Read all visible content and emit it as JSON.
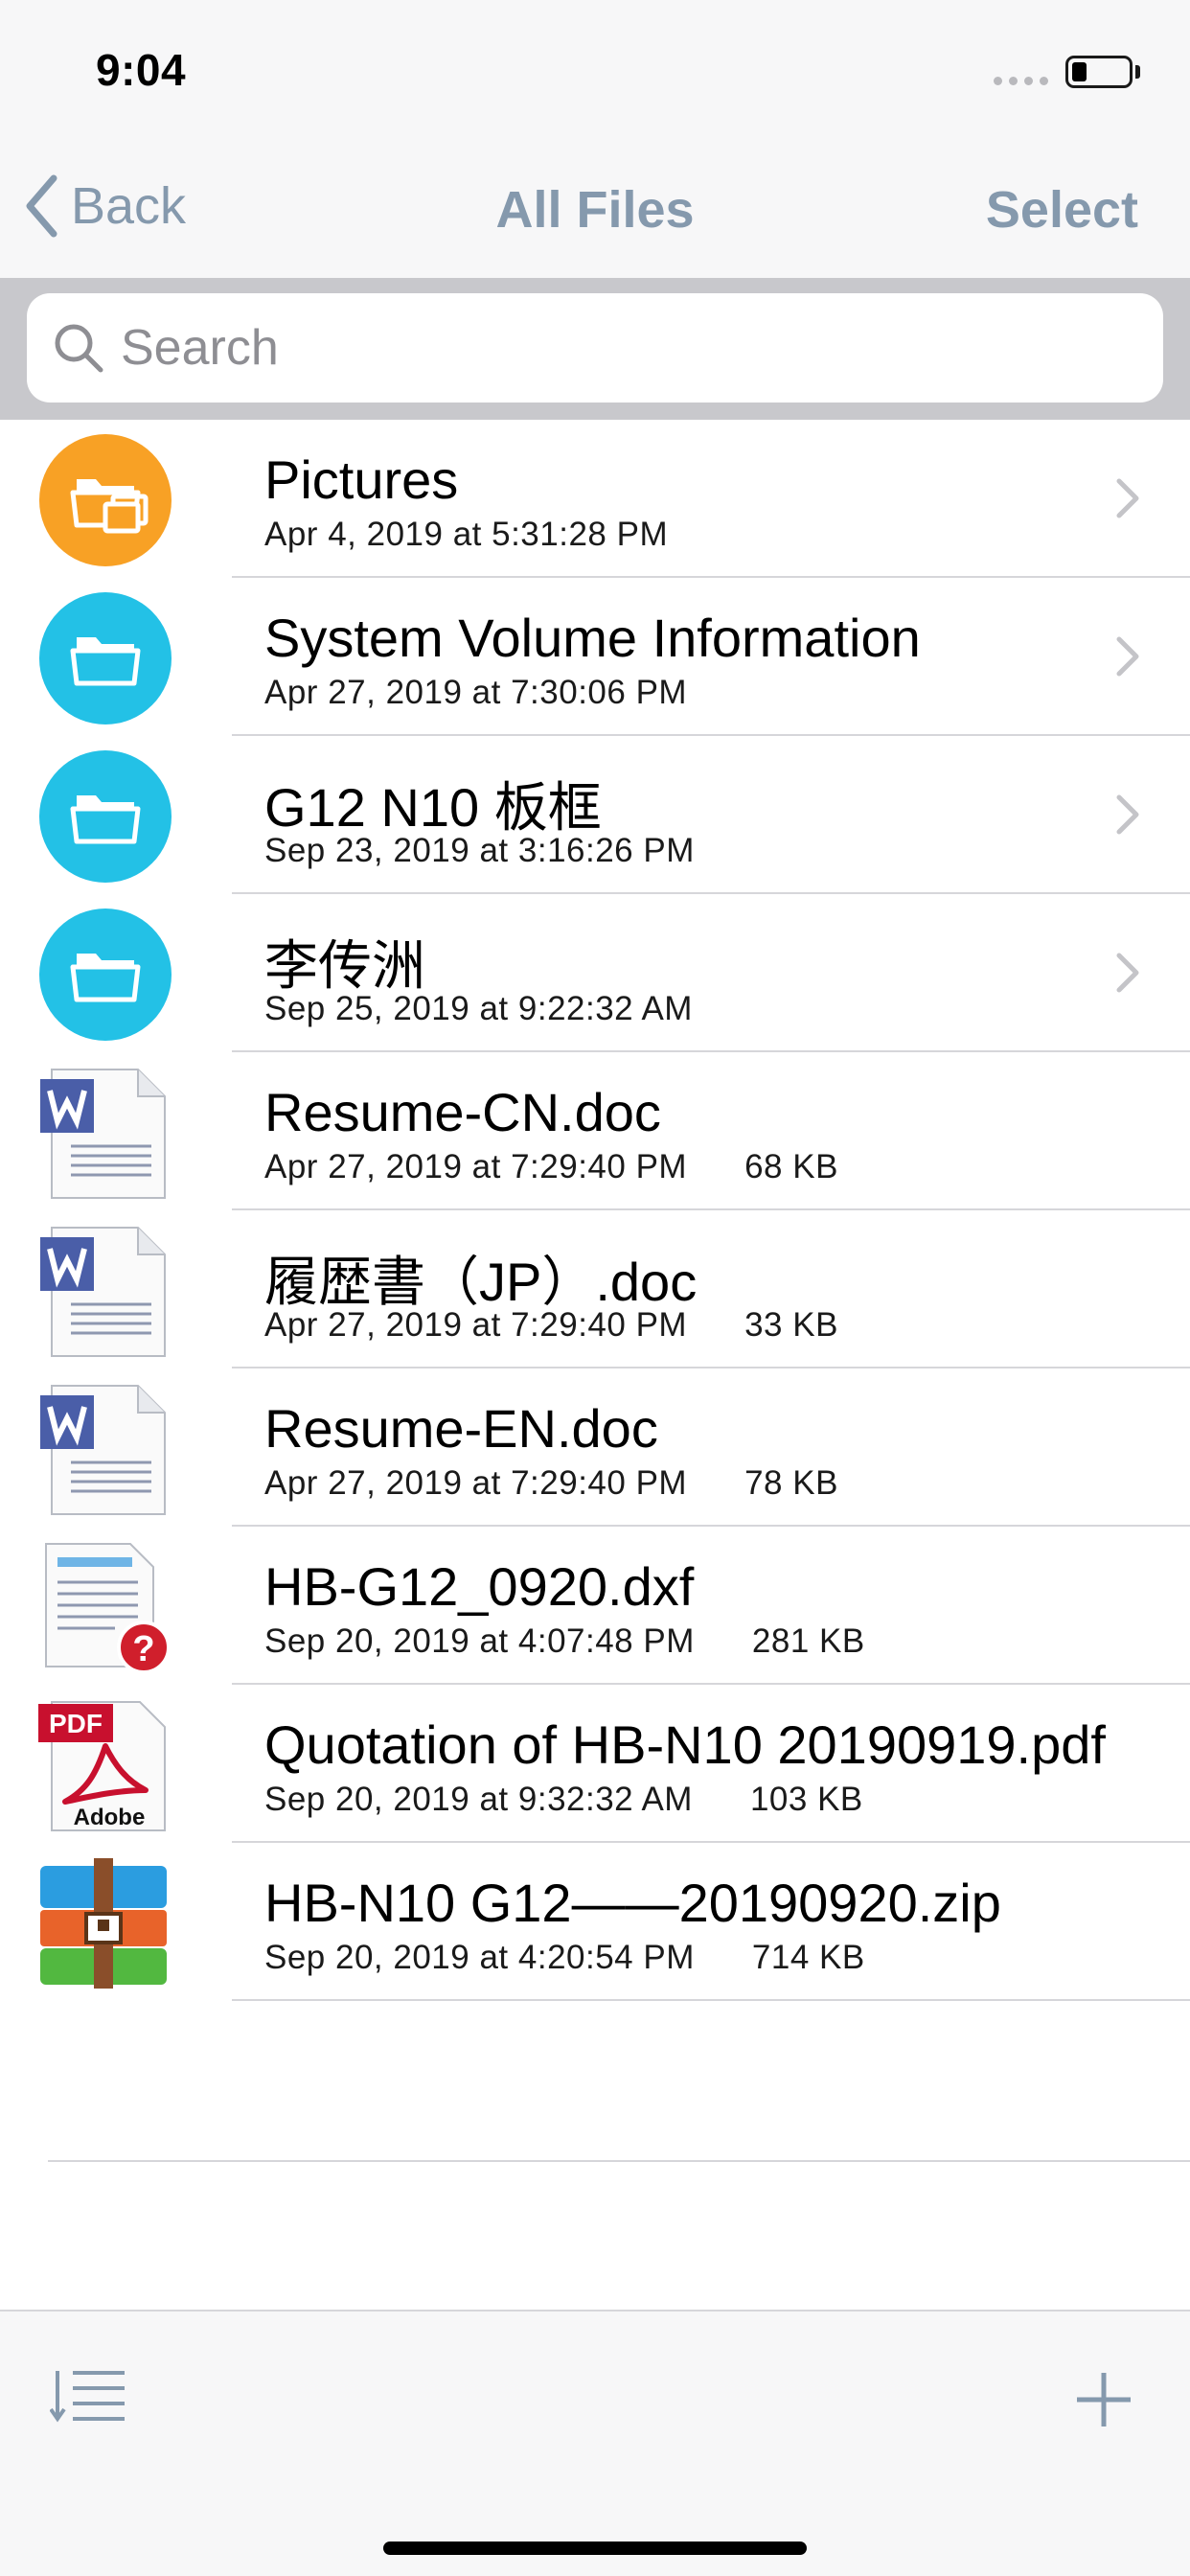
{
  "status": {
    "time": "9:04",
    "battery_level": 0.25
  },
  "nav": {
    "back_label": "Back",
    "title": "All Files",
    "select_label": "Select"
  },
  "search": {
    "placeholder": "Search",
    "value": ""
  },
  "files": [
    {
      "name": "Pictures",
      "date": "Apr 4, 2019 at 5:31:28 PM",
      "size": "",
      "kind": "folder",
      "icon": "pictures-folder-icon",
      "color": "#f8a125"
    },
    {
      "name": "System Volume Information",
      "date": "Apr 27, 2019 at 7:30:06 PM",
      "size": "",
      "kind": "folder",
      "icon": "folder-icon",
      "color": "#23c1e6"
    },
    {
      "name": "G12 N10 板框",
      "date": "Sep 23, 2019 at 3:16:26 PM",
      "size": "",
      "kind": "folder",
      "icon": "folder-icon",
      "color": "#23c1e6"
    },
    {
      "name": "李传洲",
      "date": "Sep 25, 2019 at 9:22:32 AM",
      "size": "",
      "kind": "folder",
      "icon": "folder-icon",
      "color": "#23c1e6"
    },
    {
      "name": "Resume-CN.doc",
      "date": "Apr 27, 2019 at 7:29:40 PM",
      "size": "68 KB",
      "kind": "doc",
      "icon": "word-document-icon"
    },
    {
      "name": "履歴書（JP）.doc",
      "date": "Apr 27, 2019 at 7:29:40 PM",
      "size": "33 KB",
      "kind": "doc",
      "icon": "word-document-icon"
    },
    {
      "name": "Resume-EN.doc",
      "date": "Apr 27, 2019 at 7:29:40 PM",
      "size": "78 KB",
      "kind": "doc",
      "icon": "word-document-icon"
    },
    {
      "name": "HB-G12_0920.dxf",
      "date": "Sep 20, 2019 at 4:07:48 PM",
      "size": "281 KB",
      "kind": "unknown",
      "icon": "unknown-file-icon"
    },
    {
      "name": "Quotation of HB-N10 20190919.pdf",
      "date": "Sep 20, 2019 at 9:32:32 AM",
      "size": "103 KB",
      "kind": "pdf",
      "icon": "pdf-file-icon",
      "badge": "PDF",
      "brand": "Adobe"
    },
    {
      "name": "HB-N10 G12——20190920.zip",
      "date": "Sep 20, 2019 at 4:20:54 PM",
      "size": "714 KB",
      "kind": "zip",
      "icon": "zip-archive-icon"
    }
  ],
  "toolbar": {
    "sort_icon": "sort-list-icon",
    "add_icon": "plus-icon"
  },
  "colors": {
    "accent": "#8599ad",
    "separator": "#d6d6da",
    "folder_blue": "#23c1e6",
    "folder_orange": "#f8a125"
  }
}
